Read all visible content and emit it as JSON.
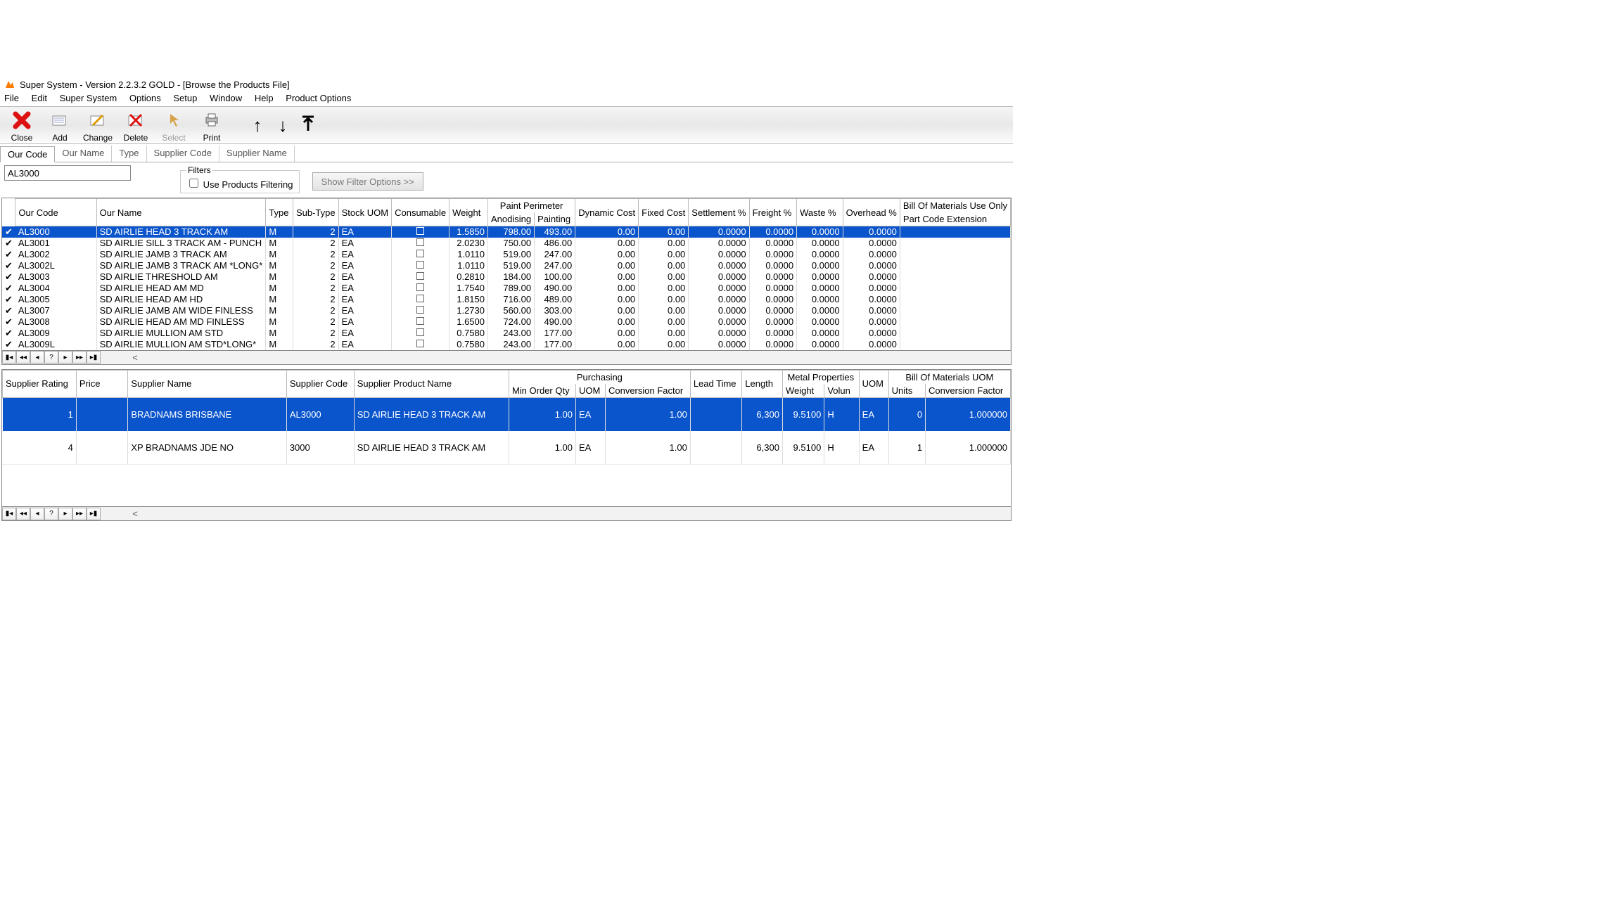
{
  "window": {
    "title": "Super System - Version 2.2.3.2 GOLD - [Browse the Products File]"
  },
  "menu": [
    "File",
    "Edit",
    "Super System",
    "Options",
    "Setup",
    "Window",
    "Help",
    "Product Options"
  ],
  "toolbar": {
    "close": "Close",
    "add": "Add",
    "change": "Change",
    "delete": "Delete",
    "select": "Select",
    "print": "Print"
  },
  "tabs": [
    "Our Code",
    "Our Name",
    "Type",
    "Supplier Code",
    "Supplier Name"
  ],
  "filter": {
    "code_value": "AL3000",
    "legend": "Filters",
    "use_label": "Use Products Filtering",
    "show_button": "Show Filter Options >>"
  },
  "prod_headers": {
    "our_code": "Our Code",
    "our_name": "Our Name",
    "type": "Type",
    "sub_type": "Sub-Type",
    "stock_uom": "Stock UOM",
    "consumable": "Consumable",
    "weight": "Weight",
    "paint_group": "Paint Perimeter",
    "anodising": "Anodising",
    "painting": "Painting",
    "dynamic_cost": "Dynamic Cost",
    "fixed_cost": "Fixed Cost",
    "settlement": "Settlement %",
    "freight": "Freight %",
    "waste": "Waste %",
    "overhead": "Overhead %",
    "bom_group": "Bill Of Materials Use Only",
    "part_ext": "Part Code Extension"
  },
  "products": [
    {
      "code": "AL3000",
      "name": "SD AIRLIE  HEAD 3 TRACK AM",
      "type": "M",
      "sub": "2",
      "uom": "EA",
      "weight": "1.5850",
      "anod": "798.00",
      "paint": "493.00",
      "dyn": "0.00",
      "fix": "0.00",
      "set": "0.0000",
      "fr": "0.0000",
      "wa": "0.0000",
      "ov": "0.0000",
      "sel": true
    },
    {
      "code": "AL3001",
      "name": "SD AIRLIE  SILL 3 TRACK AM - PUNCH",
      "type": "M",
      "sub": "2",
      "uom": "EA",
      "weight": "2.0230",
      "anod": "750.00",
      "paint": "486.00",
      "dyn": "0.00",
      "fix": "0.00",
      "set": "0.0000",
      "fr": "0.0000",
      "wa": "0.0000",
      "ov": "0.0000"
    },
    {
      "code": "AL3002",
      "name": "SD AIRLIE  JAMB 3 TRACK AM",
      "type": "M",
      "sub": "2",
      "uom": "EA",
      "weight": "1.0110",
      "anod": "519.00",
      "paint": "247.00",
      "dyn": "0.00",
      "fix": "0.00",
      "set": "0.0000",
      "fr": "0.0000",
      "wa": "0.0000",
      "ov": "0.0000"
    },
    {
      "code": "AL3002L",
      "name": "SD AIRLIE JAMB 3 TRACK AM *LONG*",
      "type": "M",
      "sub": "2",
      "uom": "EA",
      "weight": "1.0110",
      "anod": "519.00",
      "paint": "247.00",
      "dyn": "0.00",
      "fix": "0.00",
      "set": "0.0000",
      "fr": "0.0000",
      "wa": "0.0000",
      "ov": "0.0000"
    },
    {
      "code": "AL3003",
      "name": "SD AIRLIE THRESHOLD AM",
      "type": "M",
      "sub": "2",
      "uom": "EA",
      "weight": "0.2810",
      "anod": "184.00",
      "paint": "100.00",
      "dyn": "0.00",
      "fix": "0.00",
      "set": "0.0000",
      "fr": "0.0000",
      "wa": "0.0000",
      "ov": "0.0000"
    },
    {
      "code": "AL3004",
      "name": "SD AIRLIE HEAD AM MD",
      "type": "M",
      "sub": "2",
      "uom": "EA",
      "weight": "1.7540",
      "anod": "789.00",
      "paint": "490.00",
      "dyn": "0.00",
      "fix": "0.00",
      "set": "0.0000",
      "fr": "0.0000",
      "wa": "0.0000",
      "ov": "0.0000"
    },
    {
      "code": "AL3005",
      "name": "SD AIRLIE HEAD AM HD",
      "type": "M",
      "sub": "2",
      "uom": "EA",
      "weight": "1.8150",
      "anod": "716.00",
      "paint": "489.00",
      "dyn": "0.00",
      "fix": "0.00",
      "set": "0.0000",
      "fr": "0.0000",
      "wa": "0.0000",
      "ov": "0.0000"
    },
    {
      "code": "AL3007",
      "name": "SD AIRLIE JAMB AM WIDE FINLESS",
      "type": "M",
      "sub": "2",
      "uom": "EA",
      "weight": "1.2730",
      "anod": "560.00",
      "paint": "303.00",
      "dyn": "0.00",
      "fix": "0.00",
      "set": "0.0000",
      "fr": "0.0000",
      "wa": "0.0000",
      "ov": "0.0000"
    },
    {
      "code": "AL3008",
      "name": "SD AIRLIE HEAD AM MD FINLESS",
      "type": "M",
      "sub": "2",
      "uom": "EA",
      "weight": "1.6500",
      "anod": "724.00",
      "paint": "490.00",
      "dyn": "0.00",
      "fix": "0.00",
      "set": "0.0000",
      "fr": "0.0000",
      "wa": "0.0000",
      "ov": "0.0000"
    },
    {
      "code": "AL3009",
      "name": "SD AIRLIE MULLION AM STD",
      "type": "M",
      "sub": "2",
      "uom": "EA",
      "weight": "0.7580",
      "anod": "243.00",
      "paint": "177.00",
      "dyn": "0.00",
      "fix": "0.00",
      "set": "0.0000",
      "fr": "0.0000",
      "wa": "0.0000",
      "ov": "0.0000"
    },
    {
      "code": "AL3009L",
      "name": "SD AIRLIE MULLION AM STD*LONG*",
      "type": "M",
      "sub": "2",
      "uom": "EA",
      "weight": "0.7580",
      "anod": "243.00",
      "paint": "177.00",
      "dyn": "0.00",
      "fix": "0.00",
      "set": "0.0000",
      "fr": "0.0000",
      "wa": "0.0000",
      "ov": "0.0000"
    }
  ],
  "sup_headers": {
    "rating": "Supplier Rating",
    "price": "Price",
    "name": "Supplier Name",
    "code": "Supplier Code",
    "prod_name": "Supplier Product Name",
    "purch_group": "Purchasing",
    "min_qty": "Min Order Qty",
    "uom": "UOM",
    "conv": "Conversion Factor",
    "lead": "Lead Time",
    "length": "Length",
    "metal_group": "Metal Properties",
    "weight": "Weight",
    "volun": "Volun",
    "bom_uom_h": "UOM",
    "bom_group": "Bill Of Materials UOM",
    "units": "Units",
    "bom_conv": "Conversion Factor"
  },
  "suppliers": [
    {
      "rating": "1",
      "price": "",
      "name": "BRADNAMS BRISBANE",
      "code": "AL3000",
      "pname": "SD AIRLIE  HEAD 3 TRACK AM",
      "minqty": "1.00",
      "uom": "EA",
      "conv": "1.00",
      "lead": "",
      "len": "6,300",
      "weight": "9.5100",
      "vol": "H",
      "buom": "EA",
      "units": "0",
      "bconv": "1.000000",
      "sel": true
    },
    {
      "rating": "4",
      "price": "",
      "name": "XP BRADNAMS JDE NO",
      "code": "3000",
      "pname": "SD AIRLIE  HEAD 3 TRACK AM",
      "minqty": "1.00",
      "uom": "EA",
      "conv": "1.00",
      "lead": "",
      "len": "6,300",
      "weight": "9.5100",
      "vol": "H",
      "buom": "EA",
      "units": "1",
      "bconv": "1.000000"
    }
  ]
}
